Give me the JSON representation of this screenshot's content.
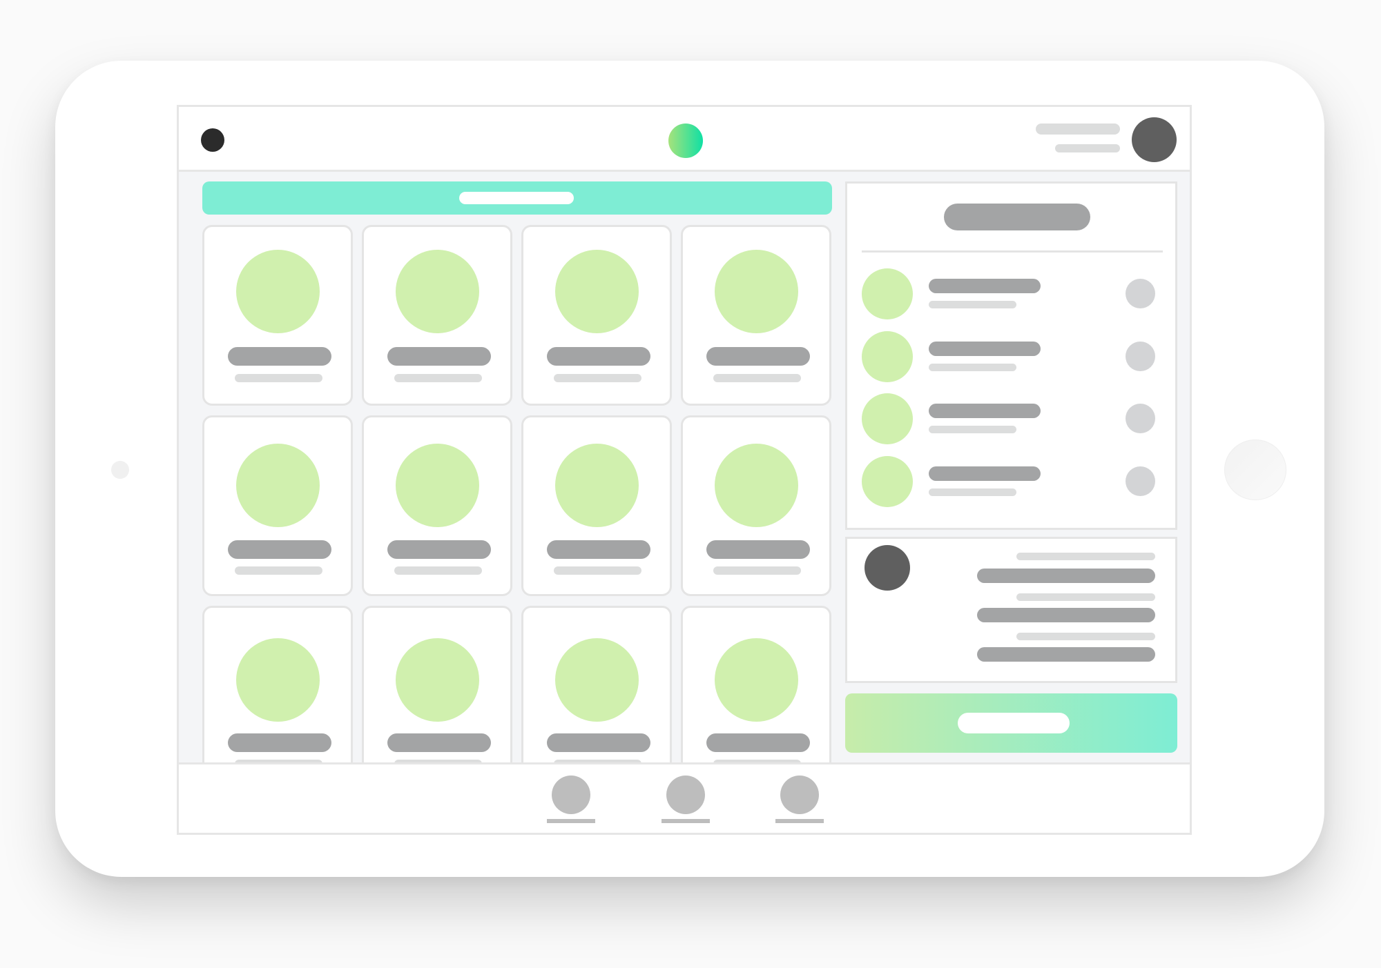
{
  "colors": {
    "accent": "#7eedd4",
    "gradient_start": "#c7ecaa",
    "gradient_end": "#7eedd4",
    "avatar_fill": "#d0f0ae",
    "placeholder_dark": "#a3a4a5",
    "placeholder_light": "#dcdddd"
  },
  "header": {
    "menu_icon": "dot-icon",
    "logo_icon": "gradient-circle-logo",
    "profile_icon": "avatar"
  },
  "grid": {
    "cards": [
      {
        "title": "",
        "subtitle": ""
      },
      {
        "title": "",
        "subtitle": ""
      },
      {
        "title": "",
        "subtitle": ""
      },
      {
        "title": "",
        "subtitle": ""
      },
      {
        "title": "",
        "subtitle": ""
      },
      {
        "title": "",
        "subtitle": ""
      },
      {
        "title": "",
        "subtitle": ""
      },
      {
        "title": "",
        "subtitle": ""
      },
      {
        "title": "",
        "subtitle": ""
      },
      {
        "title": "",
        "subtitle": ""
      },
      {
        "title": "",
        "subtitle": ""
      },
      {
        "title": "",
        "subtitle": ""
      }
    ]
  },
  "sidebar": {
    "list_items": [
      {
        "title": "",
        "subtitle": ""
      },
      {
        "title": "",
        "subtitle": ""
      },
      {
        "title": "",
        "subtitle": ""
      },
      {
        "title": "",
        "subtitle": ""
      }
    ]
  },
  "bottom_nav": {
    "items": [
      {
        "icon": "nav-icon",
        "label": ""
      },
      {
        "icon": "nav-icon",
        "label": ""
      },
      {
        "icon": "nav-icon",
        "label": ""
      }
    ]
  }
}
